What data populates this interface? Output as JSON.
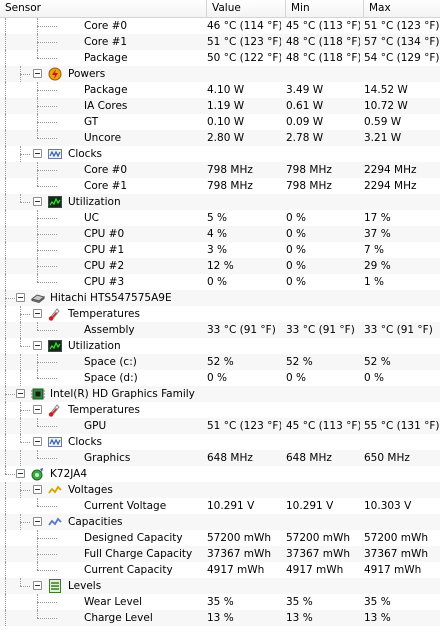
{
  "columns": [
    "Sensor",
    "Value",
    "Min",
    "Max"
  ],
  "rows": [
    {
      "level": 3,
      "label": "Core #0",
      "value": "46 °C  (114 °F)",
      "min": "45 °C  (113 °F)",
      "max": "51 °C  (123 °F)"
    },
    {
      "level": 3,
      "label": "Core #1",
      "value": "51 °C  (123 °F)",
      "min": "48 °C  (118 °F)",
      "max": "57 °C  (134 °F)"
    },
    {
      "level": 3,
      "label": "Package",
      "value": "50 °C  (122 °F)",
      "min": "48 °C  (118 °F)",
      "max": "54 °C  (129 °F)",
      "last": true
    },
    {
      "level": 2,
      "label": "Powers",
      "icon": "power-icon",
      "toggle": true
    },
    {
      "level": 3,
      "label": "Package",
      "value": "4.10 W",
      "min": "3.49 W",
      "max": "14.52 W"
    },
    {
      "level": 3,
      "label": "IA Cores",
      "value": "1.19 W",
      "min": "0.61 W",
      "max": "10.72 W"
    },
    {
      "level": 3,
      "label": "GT",
      "value": "0.10 W",
      "min": "0.09 W",
      "max": "0.59 W"
    },
    {
      "level": 3,
      "label": "Uncore",
      "value": "2.80 W",
      "min": "2.78 W",
      "max": "3.21 W",
      "last": true
    },
    {
      "level": 2,
      "label": "Clocks",
      "icon": "clock-icon",
      "toggle": true
    },
    {
      "level": 3,
      "label": "Core #0",
      "value": "798 MHz",
      "min": "798 MHz",
      "max": "2294 MHz"
    },
    {
      "level": 3,
      "label": "Core #1",
      "value": "798 MHz",
      "min": "798 MHz",
      "max": "2294 MHz",
      "last": true
    },
    {
      "level": 2,
      "label": "Utilization",
      "icon": "utilization-icon",
      "toggle": true,
      "last": true
    },
    {
      "level": 3,
      "label": "UC",
      "value": "5 %",
      "min": "0 %",
      "max": "17 %"
    },
    {
      "level": 3,
      "label": "CPU #0",
      "value": "4 %",
      "min": "0 %",
      "max": "37 %"
    },
    {
      "level": 3,
      "label": "CPU #1",
      "value": "3 %",
      "min": "0 %",
      "max": "7 %"
    },
    {
      "level": 3,
      "label": "CPU #2",
      "value": "12 %",
      "min": "0 %",
      "max": "29 %"
    },
    {
      "level": 3,
      "label": "CPU #3",
      "value": "0 %",
      "min": "0 %",
      "max": "1 %",
      "last": true
    },
    {
      "level": 1,
      "label": "Hitachi HTS547575A9E",
      "icon": "hard-drive-icon",
      "toggle": true
    },
    {
      "level": 2,
      "label": "Temperatures",
      "icon": "thermometer-icon",
      "toggle": true
    },
    {
      "level": 3,
      "label": "Assembly",
      "value": "33 °C  (91 °F)",
      "min": "33 °C  (91 °F)",
      "max": "33 °C  (91 °F)",
      "last": true
    },
    {
      "level": 2,
      "label": "Utilization",
      "icon": "utilization-icon",
      "toggle": true,
      "last": true
    },
    {
      "level": 3,
      "label": "Space (c:)",
      "value": "52 %",
      "min": "52 %",
      "max": "52 %"
    },
    {
      "level": 3,
      "label": "Space (d:)",
      "value": "0 %",
      "min": "0 %",
      "max": "0 %",
      "last": true
    },
    {
      "level": 1,
      "label": "Intel(R) HD Graphics Family",
      "icon": "gpu-chip-icon",
      "toggle": true
    },
    {
      "level": 2,
      "label": "Temperatures",
      "icon": "thermometer-icon",
      "toggle": true
    },
    {
      "level": 3,
      "label": "GPU",
      "value": "51 °C  (123 °F)",
      "min": "45 °C  (113 °F)",
      "max": "55 °C  (131 °F)",
      "last": true
    },
    {
      "level": 2,
      "label": "Clocks",
      "icon": "clock-icon",
      "toggle": true,
      "last": true
    },
    {
      "level": 3,
      "label": "Graphics",
      "value": "648 MHz",
      "min": "648 MHz",
      "max": "650 MHz",
      "last": true
    },
    {
      "level": 1,
      "label": "K72JA4",
      "icon": "battery-icon",
      "toggle": true,
      "last": true
    },
    {
      "level": 2,
      "label": "Voltages",
      "icon": "voltage-icon",
      "toggle": true
    },
    {
      "level": 3,
      "label": "Current Voltage",
      "value": "10.291 V",
      "min": "10.291 V",
      "max": "10.303 V",
      "last": true
    },
    {
      "level": 2,
      "label": "Capacities",
      "icon": "capacity-icon",
      "toggle": true
    },
    {
      "level": 3,
      "label": "Designed Capacity",
      "value": "57200 mWh",
      "min": "57200 mWh",
      "max": "57200 mWh"
    },
    {
      "level": 3,
      "label": "Full Charge Capacity",
      "value": "37367 mWh",
      "min": "37367 mWh",
      "max": "37367 mWh"
    },
    {
      "level": 3,
      "label": "Current Capacity",
      "value": "4917 mWh",
      "min": "4917 mWh",
      "max": "4917 mWh",
      "last": true
    },
    {
      "level": 2,
      "label": "Levels",
      "icon": "levels-icon",
      "toggle": true,
      "last": true
    },
    {
      "level": 3,
      "label": "Wear Level",
      "value": "35 %",
      "min": "35 %",
      "max": "35 %"
    },
    {
      "level": 3,
      "label": "Charge Level",
      "value": "13 %",
      "min": "13 %",
      "max": "13 %",
      "last": true
    }
  ]
}
